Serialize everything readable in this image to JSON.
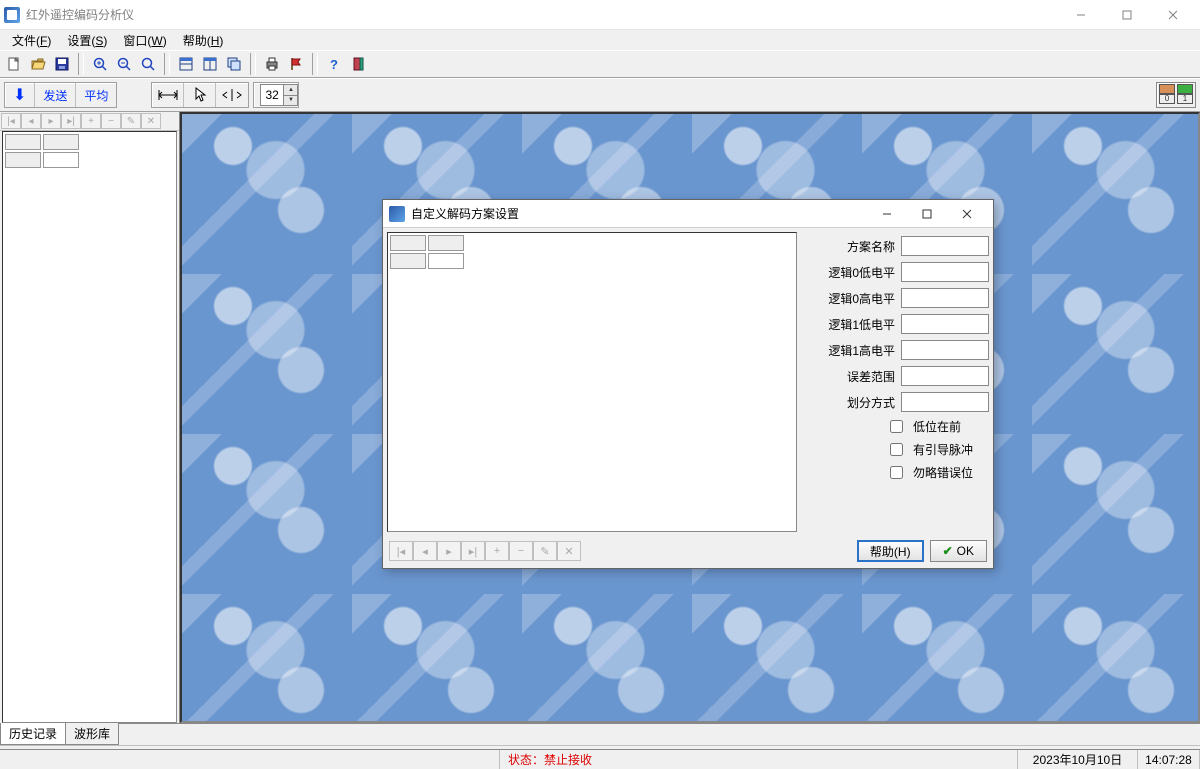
{
  "app": {
    "title": "红外遥控编码分析仪"
  },
  "menu": {
    "file": "文件",
    "file_k": "F",
    "settings": "设置",
    "settings_k": "S",
    "window": "窗口",
    "window_k": "W",
    "help": "帮助",
    "help_k": "H"
  },
  "toolbar2": {
    "arrow": "↓",
    "send": "发送",
    "avg": "平均",
    "spin_value": "32"
  },
  "side": {
    "tab_history": "历史记录",
    "tab_waveform": "波形库"
  },
  "dialog": {
    "title": "自定义解码方案设置",
    "fields": {
      "scheme_name": "方案名称",
      "logic0_low": "逻辑0低电平",
      "logic0_high": "逻辑0高电平",
      "logic1_low": "逻辑1低电平",
      "logic1_high": "逻辑1高电平",
      "tolerance": "误差范围",
      "split_mode": "划分方式"
    },
    "values": {
      "scheme_name": "",
      "logic0_low": "",
      "logic0_high": "",
      "logic1_low": "",
      "logic1_high": "",
      "tolerance": "",
      "split_mode": ""
    },
    "checks": {
      "lsb_first": "低位在前",
      "lead_pulse": "有引导脉冲",
      "ignore_err": "勿略错误位"
    },
    "help_btn": "帮助(H)",
    "ok_btn": "OK"
  },
  "status": {
    "center": "状态：禁止接收",
    "date": "2023年10月10日",
    "time": "14:07:28"
  },
  "lights": {
    "top_left": "orange",
    "top_right": "green",
    "bot_left": "0",
    "bot_right": "1"
  }
}
